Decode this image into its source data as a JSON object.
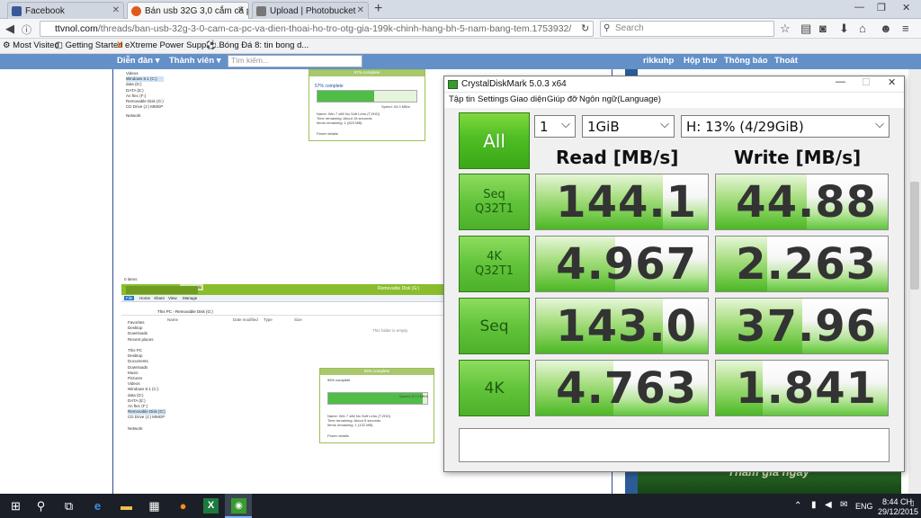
{
  "browser": {
    "tabs": [
      {
        "title": "Facebook",
        "color": "#3b5998",
        "active": false
      },
      {
        "title": "Bán usb 32G 3,0 cắm cả p...",
        "color": "#e05a1c",
        "active": true
      },
      {
        "title": "Upload | Photobucket",
        "color": "#555555",
        "active": false
      }
    ],
    "url_host": "ttvnol.com",
    "url_path": "/threads/ban-usb-32g-3-0-cam-ca-pc-va-dien-thoai-ho-tro-otg-gia-199k-chinh-hang-bh-5-nam-bang-tem.1753932/",
    "search_placeholder": "Search",
    "bookmarks": [
      "Most Visited",
      "Getting Started",
      "eXtreme Power Supply...",
      "Bóng Đá 8: tin bong d..."
    ]
  },
  "site_nav": {
    "left": [
      "Diễn đàn",
      "Thành viên"
    ],
    "search_placeholder": "Tìm kiếm...",
    "right": [
      "rikkuhp",
      "Hộp thư",
      "Thông báo",
      "Thoát"
    ]
  },
  "embedded": {
    "tree1": [
      "Videos",
      "Windows 8.1 (C:)",
      "data (D:)",
      "DATA (E:)",
      "An ftec (F:)",
      "Removable Disk (G:)",
      "CD Drive (J:) MMGP"
    ],
    "network": "Network",
    "copy1_head": "57% complete",
    "copy1_pct": "57% complete",
    "copy1_lines": [
      "Name: Win 7 x86 No Soft Lehu (T:2HO)",
      "Time remaining: About 15 seconds",
      "Items remaining: 1 (823 MB)"
    ],
    "copy1_speed": "Speed: 93.0 MB/s",
    "fewer": "Fewer details",
    "items": "0 items",
    "drive_tools": "Drive Tools",
    "explorer_title": "Removable Disk (G:)",
    "ribbon": [
      "File",
      "Home",
      "Share",
      "View",
      "Manage"
    ],
    "address": "This PC  ›  Removable Disk (G:)",
    "cols": [
      "Name",
      "Date modified",
      "Type",
      "Size"
    ],
    "empty": "This folder is empty.",
    "tree2": [
      "Favorites",
      "Desktop",
      "Downloads",
      "Recent places",
      "",
      "This PC",
      "Desktop",
      "Documents",
      "Downloads",
      "Music",
      "Pictures",
      "Videos",
      "Windows 8.1 (C:)",
      "data (D:)",
      "DATA (E:)",
      "An ftec (F:)",
      "Removable Disk (G:)",
      "CD Drive (J:) MMGP",
      "",
      "Network"
    ],
    "copy2_head": "95% complete",
    "copy2_pct": "95% complete",
    "copy2_speed": "Speed: 47.0 MB/s",
    "copy2_lines": [
      "Name: Win 7 x86 No Soft Lehu (T:2HO)",
      "Time remaining: About 5 seconds",
      "Items remaining: 1 (102 MB)"
    ],
    "copy2_progress": 0.95,
    "copy1_progress": 0.57
  },
  "banner_text": "Tham gia ngay",
  "cdm": {
    "title": "CrystalDiskMark 5.0.3 x64",
    "menu": [
      "Tập tin",
      "Settings",
      "Giao diện",
      "Giúp đỡ",
      "Ngôn ngữ(Language)"
    ],
    "all_label": "All",
    "count": "1",
    "size": "1GiB",
    "drive": "H: 13% (4/29GiB)",
    "read_header": "Read [MB/s]",
    "write_header": "Write [MB/s]",
    "rows": [
      {
        "l1": "Seq",
        "l2": "Q32T1",
        "read": "144.1",
        "write": "44.88",
        "read_level": 0.74,
        "write_level": 0.53
      },
      {
        "l1": "4K",
        "l2": "Q32T1",
        "read": "4.967",
        "write": "2.263",
        "read_level": 0.46,
        "write_level": 0.3
      },
      {
        "l1": "Seq",
        "l2": "",
        "read": "143.0",
        "write": "37.96",
        "read_level": 0.74,
        "write_level": 0.5
      },
      {
        "l1": "4K",
        "l2": "",
        "read": "4.763",
        "write": "1.841",
        "read_level": 0.45,
        "write_level": 0.27
      }
    ],
    "comment": ""
  },
  "taskbar": {
    "lang": "ENG",
    "time": "8:44 CH",
    "date": "29/12/2015"
  }
}
